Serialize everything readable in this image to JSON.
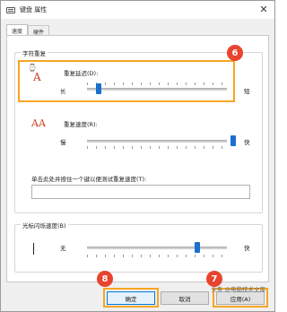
{
  "window": {
    "title": "键盘 属性",
    "close_glyph": "✕"
  },
  "tabs": [
    {
      "label": "速度",
      "active": true
    },
    {
      "label": "硬件",
      "active": false
    }
  ],
  "char_repeat": {
    "group_title": "字符重复",
    "delay": {
      "label": "重复延迟(D):",
      "left": "长",
      "right": "短",
      "level_percent": 0
    },
    "rate": {
      "label": "重复速度(R):",
      "left": "慢",
      "right": "快",
      "level_percent": 100
    },
    "test_label": "单击此处并按住一个键以便测试重复速度(T):",
    "test_value": ""
  },
  "cursor_blink": {
    "group_title": "光标闪烁速度(B)",
    "left": "无",
    "right": "快",
    "level_percent": 73
  },
  "buttons": {
    "ok": "确定",
    "cancel": "取消",
    "apply": "应用(A)"
  },
  "annotations": {
    "badge_delay": "6",
    "badge_apply": "7",
    "badge_ok": "8"
  },
  "watermark": "头条 @电脑技术文库",
  "colors": {
    "highlight": "#f5a623",
    "badge": "#e8442f",
    "slider_thumb": "#1a6fd1"
  }
}
